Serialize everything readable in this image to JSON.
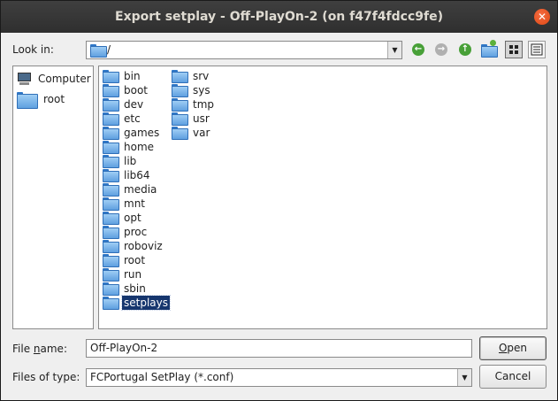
{
  "window": {
    "title": "Export setplay - Off-PlayOn-2 (on f47f4fdcc9fe)",
    "close_glyph": "✕"
  },
  "lookin": {
    "label": "Look in:",
    "value": "/"
  },
  "toolbar": {
    "back_glyph": "←",
    "forward_glyph": "→",
    "up_glyph": "↑",
    "icons": [
      "back-icon",
      "forward-icon",
      "parent-folder-icon",
      "new-folder-icon",
      "list-view-icon",
      "detail-view-icon"
    ]
  },
  "sidebar": {
    "items": [
      {
        "label": "Computer",
        "icon": "computer-icon"
      },
      {
        "label": "root",
        "icon": "folder-icon"
      }
    ]
  },
  "files": {
    "column1": [
      "bin",
      "boot",
      "dev",
      "etc",
      "games",
      "home",
      "lib",
      "lib64",
      "media",
      "mnt",
      "opt",
      "proc",
      "roboviz",
      "root",
      "run",
      "sbin",
      "setplays"
    ],
    "column2": [
      "srv",
      "sys",
      "tmp",
      "usr",
      "var"
    ],
    "selected": "setplays"
  },
  "filename": {
    "label_pre": "File ",
    "label_underlined": "n",
    "label_post": "ame:",
    "value": "Off-PlayOn-2"
  },
  "filetype": {
    "label": "Files of type:",
    "value": "FCPortugal SetPlay (*.conf)"
  },
  "buttons": {
    "open_underlined": "O",
    "open_rest": "pen",
    "cancel": "Cancel"
  },
  "colors": {
    "selection": "#16366e",
    "titlebar": "#353535",
    "close": "#e95420",
    "nav_green": "#48a038"
  }
}
